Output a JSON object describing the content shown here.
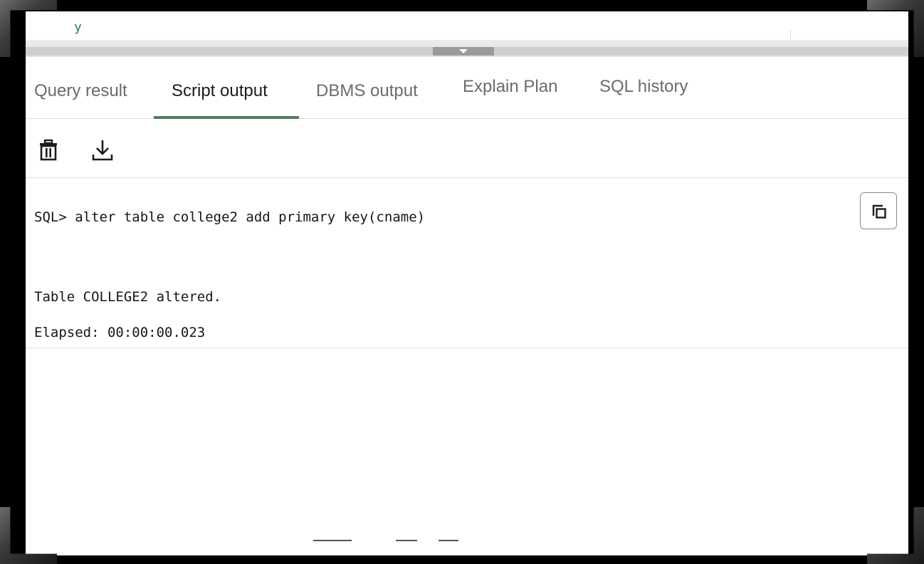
{
  "editor": {
    "partial_text": "y"
  },
  "tabs": [
    {
      "label": "Query result",
      "active": false
    },
    {
      "label": "Script output",
      "active": true
    },
    {
      "label": "DBMS output",
      "active": false
    },
    {
      "label": "Explain Plan",
      "active": false
    },
    {
      "label": "SQL history",
      "active": false
    }
  ],
  "toolbar": {
    "clear_icon": "trash-icon",
    "download_icon": "download-icon"
  },
  "output": {
    "command_line": "SQL> alter table college2 add primary key(cname)",
    "result_line": "Table COLLEGE2 altered.",
    "elapsed_line": "Elapsed: 00:00:00.023",
    "copy_icon": "copy-icon"
  },
  "colors": {
    "active_tab_underline": "#4f7d5a",
    "active_tab_text": "#1c1c1c",
    "inactive_tab_text": "#6b6b6b",
    "editor_text": "#2a7a7a"
  }
}
